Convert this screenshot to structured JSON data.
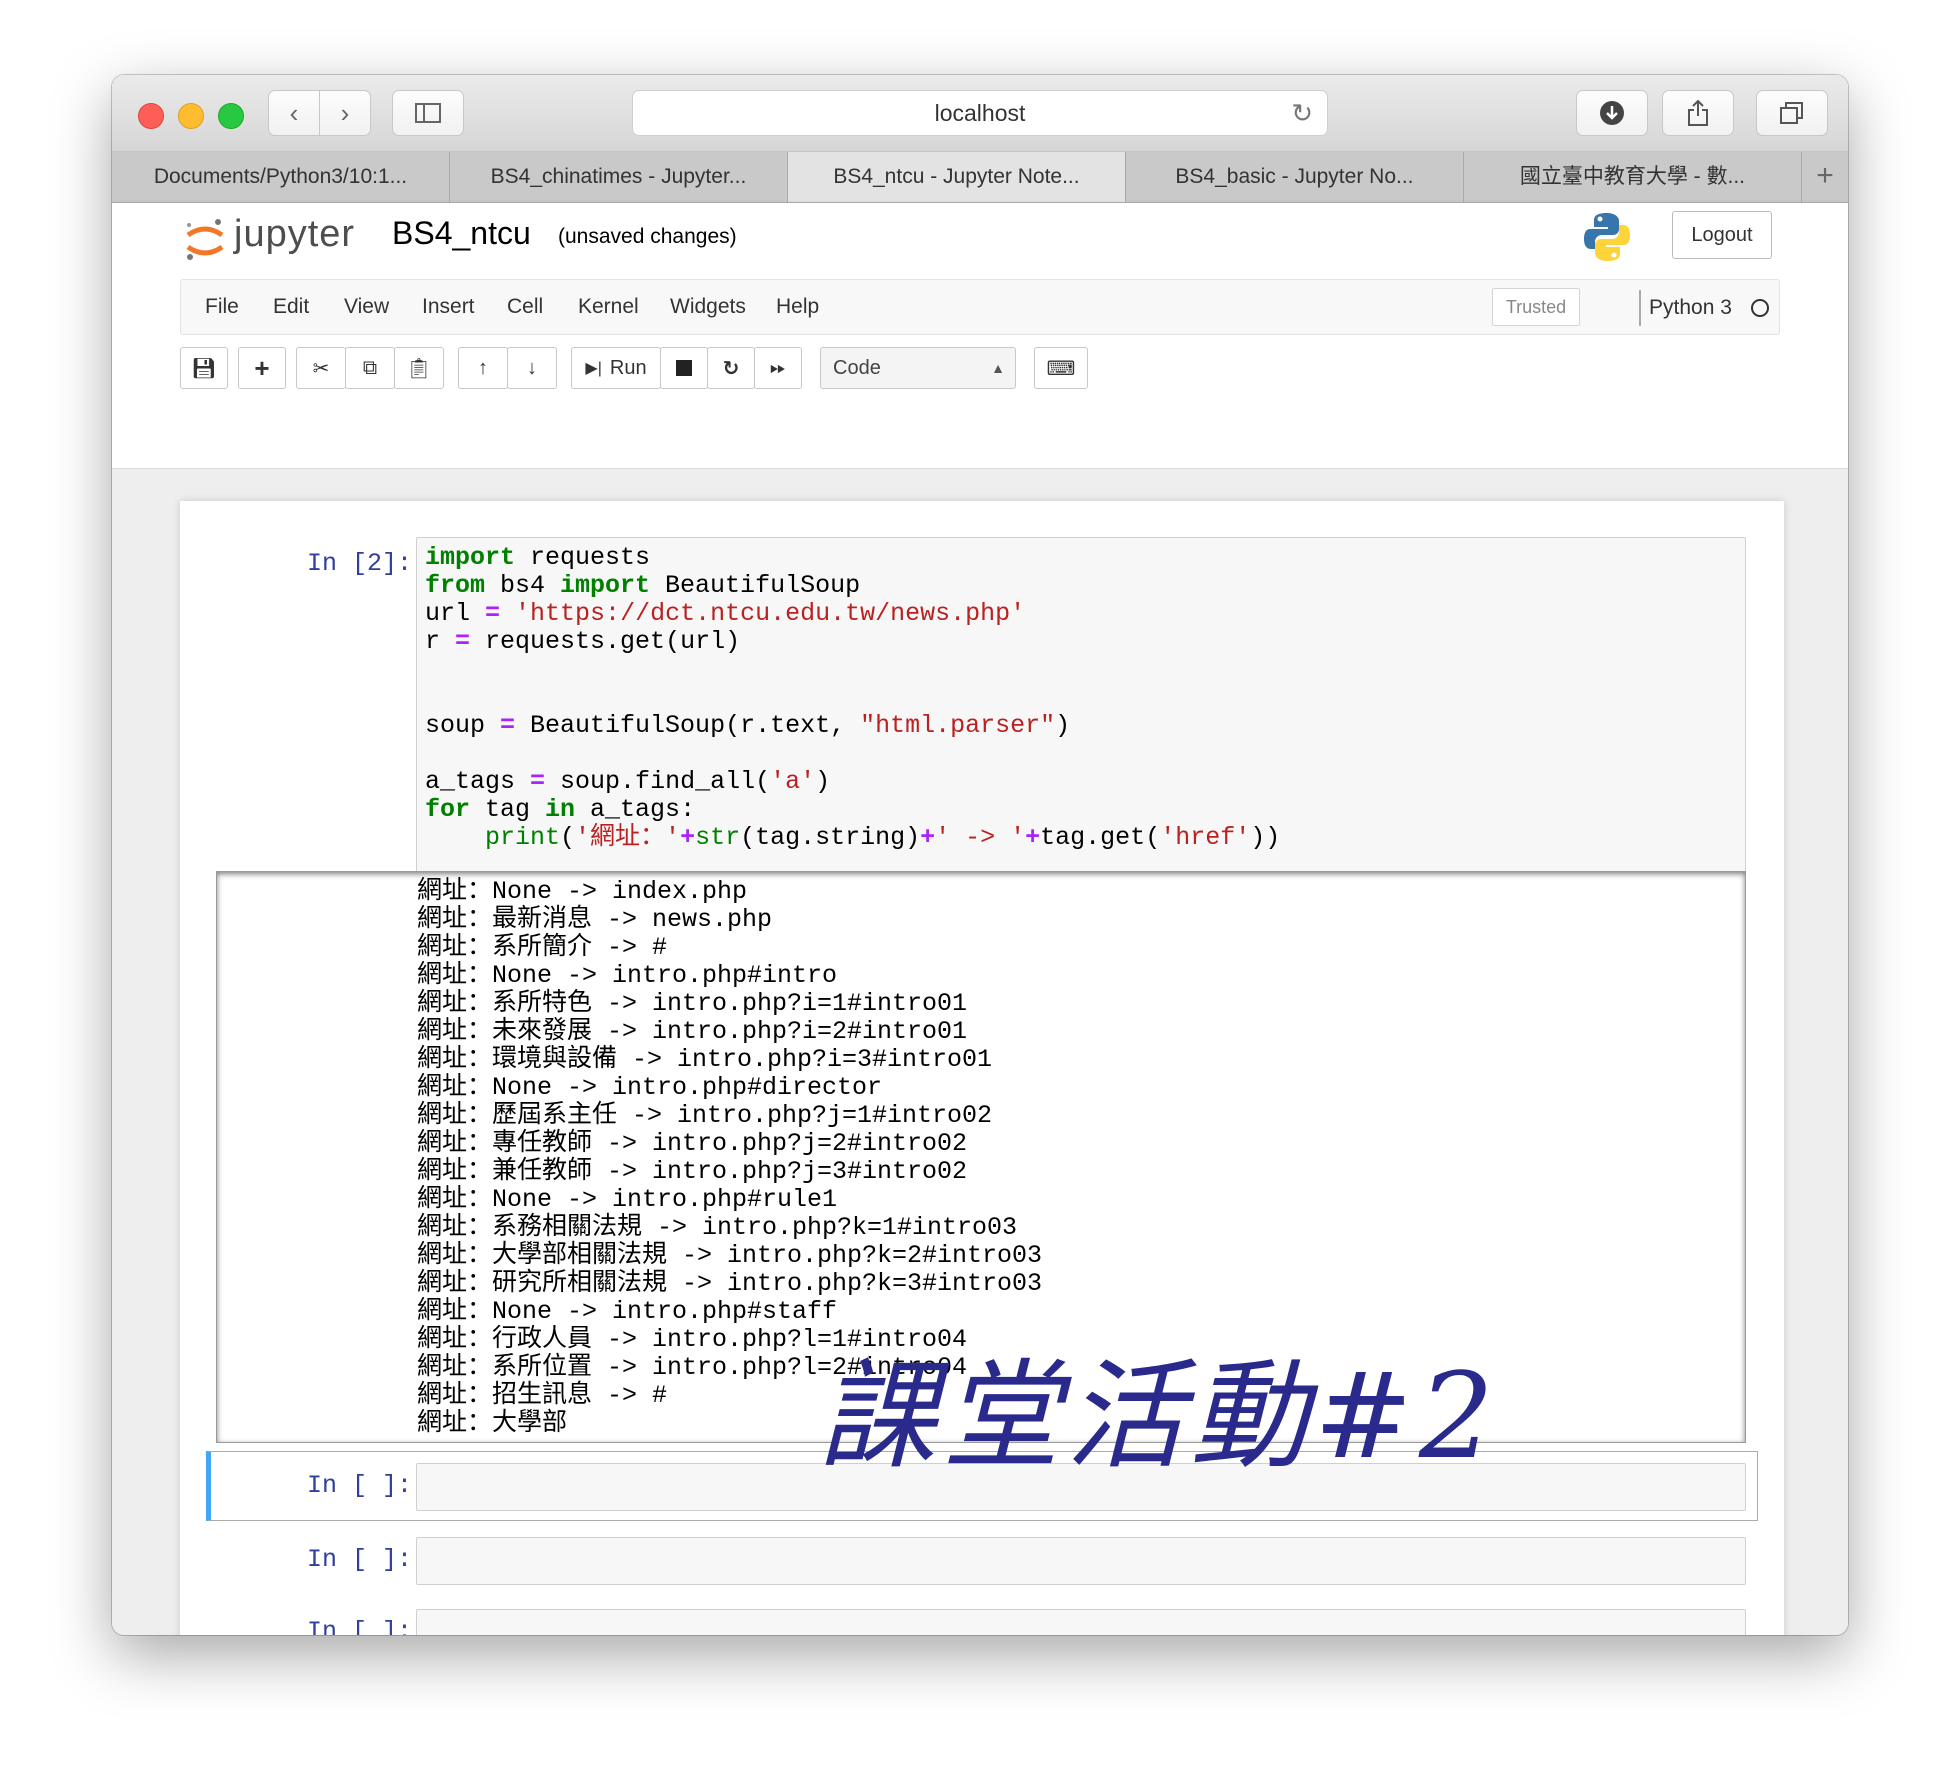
{
  "browser": {
    "address": "localhost",
    "tabs": [
      {
        "label": "Documents/Python3/10:1...",
        "active": false
      },
      {
        "label": "BS4_chinatimes - Jupyter...",
        "active": false
      },
      {
        "label": "BS4_ntcu - Jupyter Note...",
        "active": true
      },
      {
        "label": "BS4_basic - Jupyter No...",
        "active": false
      },
      {
        "label": "國立臺中教育大學 - 數...",
        "active": false
      }
    ],
    "new_tab": "+"
  },
  "jupyter": {
    "logo_text": "jupyter",
    "notebook_name": "BS4_ntcu",
    "status": "(unsaved changes)",
    "logout": "Logout",
    "menu": [
      "File",
      "Edit",
      "View",
      "Insert",
      "Cell",
      "Kernel",
      "Widgets",
      "Help"
    ],
    "trusted": "Trusted",
    "kernel": "Python 3",
    "run_label": "Run",
    "cell_type": "Code"
  },
  "cells": {
    "first_prompt": "In [2]:",
    "empty_prompt": "In [ ]:",
    "code": [
      [
        {
          "t": "import",
          "c": "kw"
        },
        {
          "t": " requests",
          "c": ""
        }
      ],
      [
        {
          "t": "from",
          "c": "kw"
        },
        {
          "t": " bs4 ",
          "c": ""
        },
        {
          "t": "import",
          "c": "kw"
        },
        {
          "t": " BeautifulSoup",
          "c": ""
        }
      ],
      [
        {
          "t": "url ",
          "c": ""
        },
        {
          "t": "=",
          "c": "op"
        },
        {
          "t": " ",
          "c": ""
        },
        {
          "t": "'https://dct.ntcu.edu.tw/news.php'",
          "c": "str"
        }
      ],
      [
        {
          "t": "r ",
          "c": ""
        },
        {
          "t": "=",
          "c": "op"
        },
        {
          "t": " requests.get(url)",
          "c": ""
        }
      ],
      [],
      [],
      [
        {
          "t": "soup ",
          "c": ""
        },
        {
          "t": "=",
          "c": "op"
        },
        {
          "t": " BeautifulSoup(r.text, ",
          "c": ""
        },
        {
          "t": "\"html.parser\"",
          "c": "str"
        },
        {
          "t": ")",
          "c": ""
        }
      ],
      [],
      [
        {
          "t": "a_tags ",
          "c": ""
        },
        {
          "t": "=",
          "c": "op"
        },
        {
          "t": " soup.find_all(",
          "c": ""
        },
        {
          "t": "'a'",
          "c": "str"
        },
        {
          "t": ")",
          "c": ""
        }
      ],
      [
        {
          "t": "for",
          "c": "kw"
        },
        {
          "t": " tag ",
          "c": ""
        },
        {
          "t": "in",
          "c": "kw"
        },
        {
          "t": " a_tags:",
          "c": ""
        }
      ],
      [
        {
          "t": "    ",
          "c": ""
        },
        {
          "t": "print",
          "c": "kw2"
        },
        {
          "t": "(",
          "c": ""
        },
        {
          "t": "'網址：'",
          "c": "str"
        },
        {
          "t": "+",
          "c": "op"
        },
        {
          "t": "str",
          "c": "kw2"
        },
        {
          "t": "(tag.string)",
          "c": ""
        },
        {
          "t": "+",
          "c": "op"
        },
        {
          "t": "' -> '",
          "c": "str"
        },
        {
          "t": "+",
          "c": "op"
        },
        {
          "t": "tag.get(",
          "c": ""
        },
        {
          "t": "'href'",
          "c": "str"
        },
        {
          "t": "))",
          "c": ""
        }
      ]
    ],
    "output": [
      "網址：None -> index.php",
      "網址：最新消息 -> news.php",
      "網址：系所簡介 -> #",
      "網址：None -> intro.php#intro",
      "網址：系所特色 -> intro.php?i=1#intro01",
      "網址：未來發展 -> intro.php?i=2#intro01",
      "網址：環境與設備 -> intro.php?i=3#intro01",
      "網址：None -> intro.php#director",
      "網址：歷屆系主任 -> intro.php?j=1#intro02",
      "網址：專任教師 -> intro.php?j=2#intro02",
      "網址：兼任教師 -> intro.php?j=3#intro02",
      "網址：None -> intro.php#rule1",
      "網址：系務相關法規 -> intro.php?k=1#intro03",
      "網址：大學部相關法規 -> intro.php?k=2#intro03",
      "網址：研究所相關法規 -> intro.php?k=3#intro03",
      "網址：None -> intro.php#staff",
      "網址：行政人員 -> intro.php?l=1#intro04",
      "網址：系所位置 -> intro.php?l=2#intro04",
      "網址：招生訊息 -> #",
      "網址：大學部"
    ]
  },
  "overlay_text": "課堂活動#2",
  "colors": {
    "prompt": "#303f9f",
    "keyword": "#008000",
    "string": "#ba2121",
    "operator": "#aa22ff",
    "overlay": "#2a2a8c",
    "selected_border": "#42a5f5"
  }
}
